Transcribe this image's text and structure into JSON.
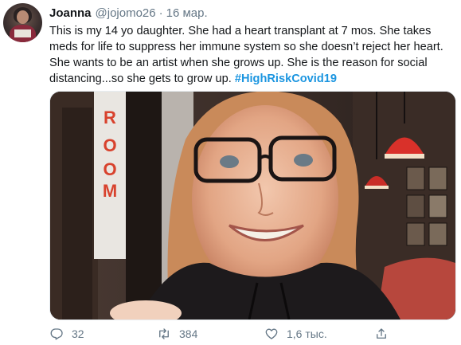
{
  "tweet": {
    "author_name": "Joanna",
    "author_handle": "@jojomo26",
    "separator": "·",
    "date": "16 мар.",
    "text": "This is my 14 yo daughter.  She had a heart transplant at 7 mos. She takes meds for life to suppress her immune system so she doesn’t reject her heart. She wants to be an artist when she grows up. She is the reason for social distancing...so she gets to grow up.",
    "hashtag": "#HighRiskCovid19"
  },
  "media": {
    "sign_letters": [
      "R",
      "O",
      "O",
      "M"
    ]
  },
  "actions": {
    "reply_count": "32",
    "retweet_count": "384",
    "like_count": "1,6 тыс.",
    "share_label": ""
  },
  "icons": {
    "reply": "reply-icon",
    "retweet": "retweet-icon",
    "like": "heart-icon",
    "share": "share-icon"
  },
  "colors": {
    "text": "#14171a",
    "secondary": "#657786",
    "link": "#1b95e0"
  }
}
